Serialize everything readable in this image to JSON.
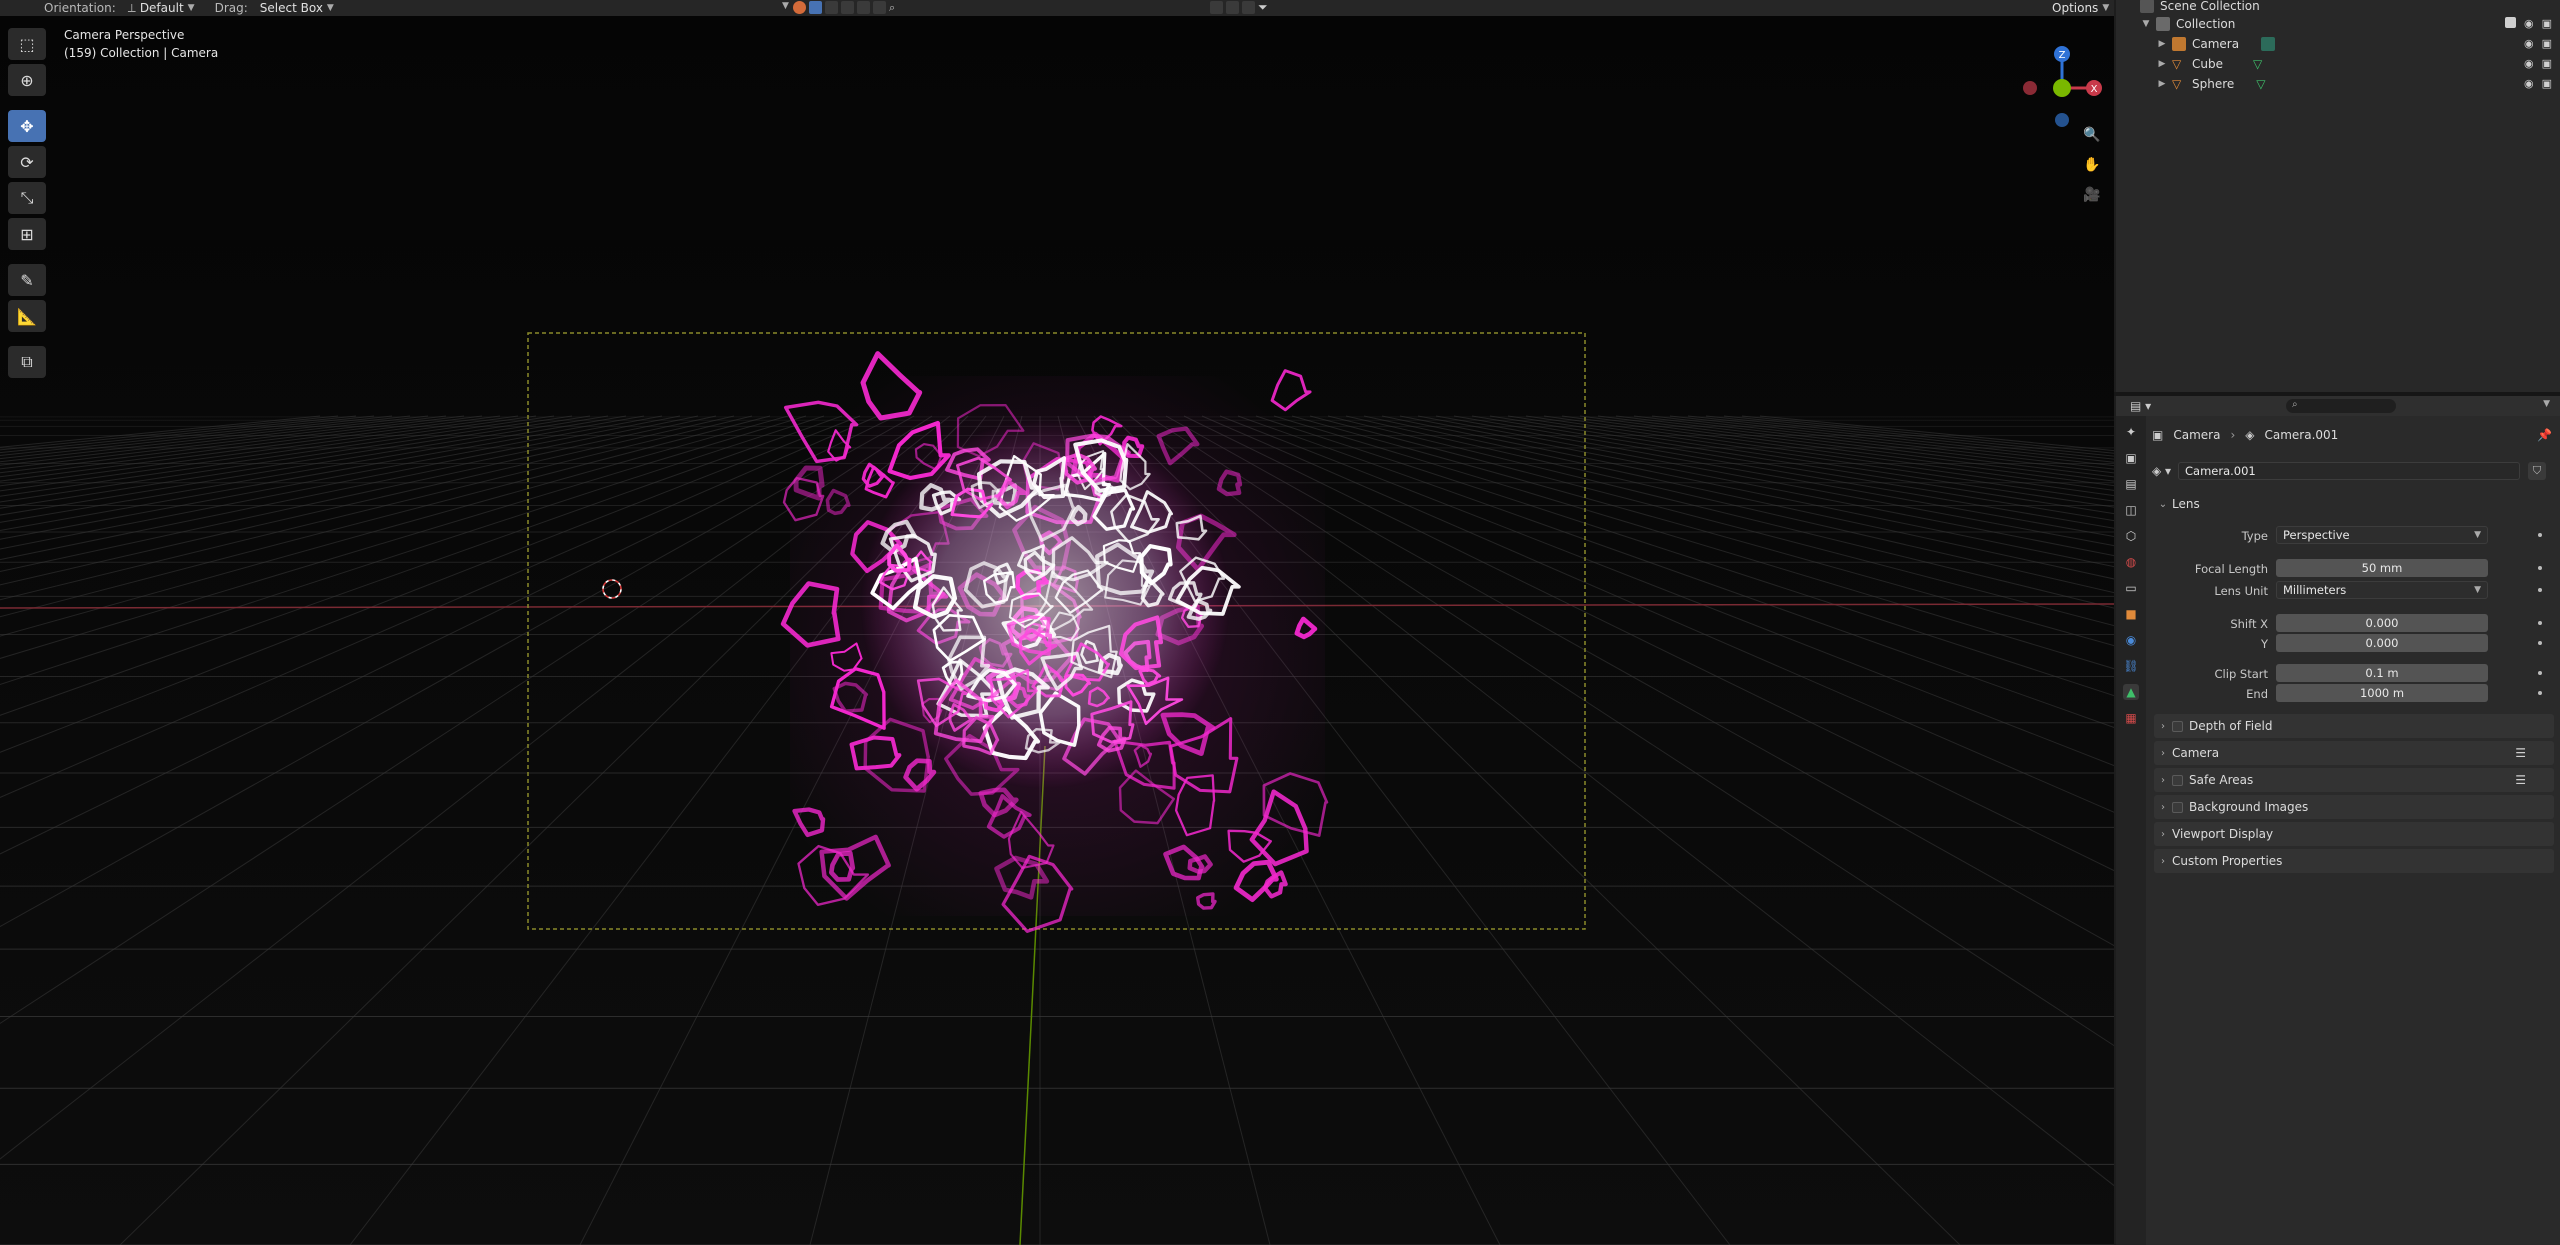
{
  "header": {
    "orientation_label": "Orientation:",
    "orientation_value": "Default",
    "drag_label": "Drag:",
    "drag_value": "Select Box",
    "options_label": "Options"
  },
  "viewport": {
    "view_name": "Camera Perspective",
    "context": "(159) Collection | Camera"
  },
  "outliner": {
    "root": "Scene Collection",
    "collection": "Collection",
    "items": [
      {
        "label": "Camera",
        "icon": "camera-object-icon"
      },
      {
        "label": "Cube",
        "icon": "mesh-object-icon"
      },
      {
        "label": "Sphere",
        "icon": "mesh-object-icon"
      }
    ]
  },
  "properties": {
    "breadcrumb_object": "Camera",
    "breadcrumb_data": "Camera.001",
    "datablock_name": "Camera.001",
    "lens_panel": "Lens",
    "type_label": "Type",
    "type_value": "Perspective",
    "focal_length_label": "Focal Length",
    "focal_length_value": "50 mm",
    "lens_unit_label": "Lens Unit",
    "lens_unit_value": "Millimeters",
    "shift_x_label": "Shift X",
    "shift_x_value": "0.000",
    "shift_y_label": "Y",
    "shift_y_value": "0.000",
    "clip_start_label": "Clip Start",
    "clip_start_value": "0.1 m",
    "clip_end_label": "End",
    "clip_end_value": "1000 m",
    "panels": [
      "Depth of Field",
      "Camera",
      "Safe Areas",
      "Background Images",
      "Viewport Display",
      "Custom Properties"
    ]
  },
  "colors": {
    "accent": "#4772b3",
    "glow_magenta": "#ff2ad8",
    "glow_white": "#ffffff",
    "camera_frame": "#8a8a2a",
    "axis_x": "#c83a4a",
    "axis_y": "#7ab800",
    "axis_z": "#2f72d6"
  }
}
